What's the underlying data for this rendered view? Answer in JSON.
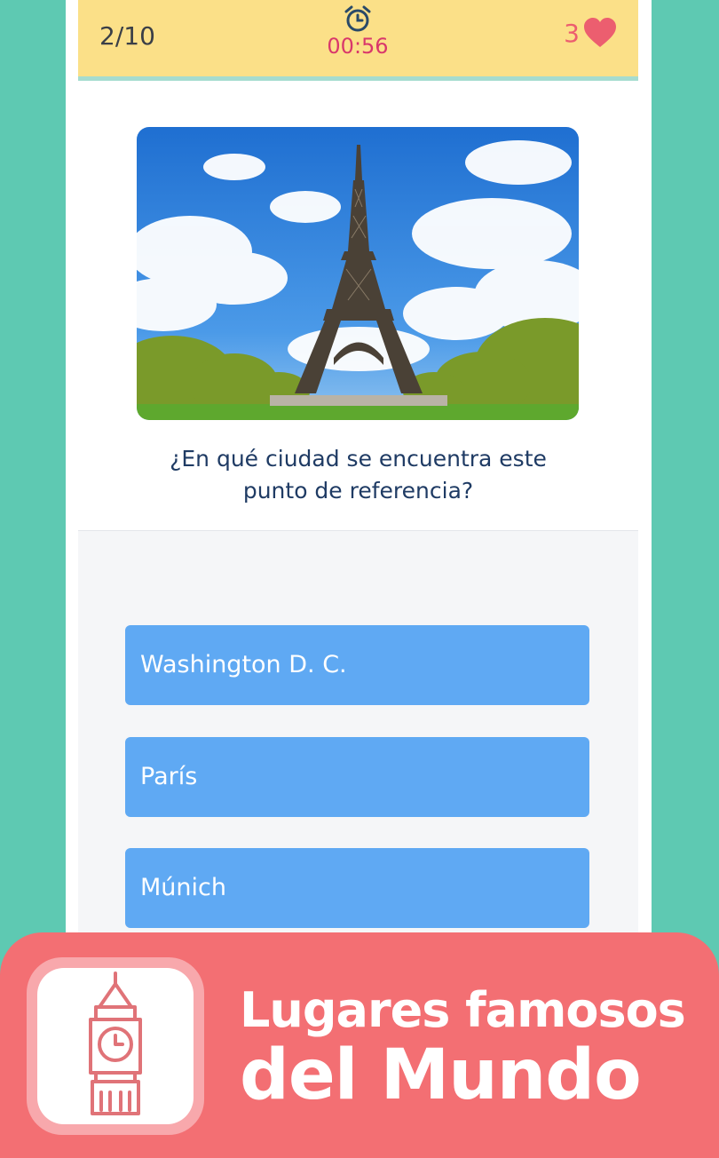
{
  "header": {
    "progress": "2/10",
    "timer": "00:56",
    "lives": "3",
    "timer_icon": "alarm-clock-icon",
    "lives_icon": "heart-icon"
  },
  "question": {
    "text_line1": "¿En qué ciudad se encuentra este",
    "text_line2": "punto de referencia?",
    "image": "eiffel-tower-photo"
  },
  "answers": [
    {
      "label": "Washington D. C."
    },
    {
      "label": "París"
    },
    {
      "label": "Múnich"
    }
  ],
  "banner": {
    "line1": "Lugares famosos",
    "line2": "del Mundo",
    "icon": "big-ben-icon"
  },
  "colors": {
    "background": "#5ec9b2",
    "topbar": "#fbe088",
    "timer": "#d9386b",
    "hearts": "#ec5e6f",
    "answer_button": "#5fa9f3",
    "banner": "#f36f73",
    "question_text": "#1f3b64"
  }
}
